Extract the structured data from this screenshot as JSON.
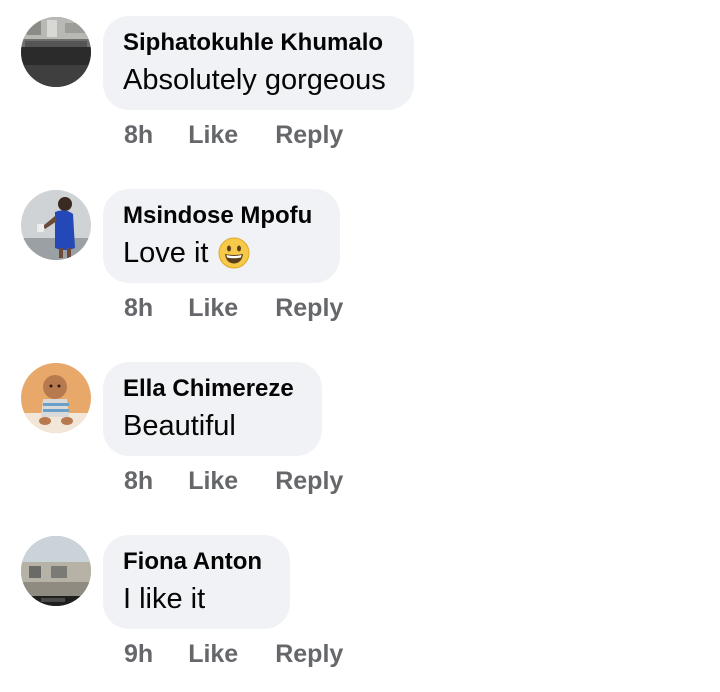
{
  "comments": [
    {
      "author": "Siphatokuhle Khumalo",
      "text": "Absolutely gorgeous",
      "emoji": "",
      "time": "8h",
      "like_label": "Like",
      "reply_label": "Reply",
      "avatar": "avatar-kitchen-photo"
    },
    {
      "author": "Msindose Mpofu",
      "text": "Love it",
      "emoji": "grinning-face-emoji",
      "time": "8h",
      "like_label": "Like",
      "reply_label": "Reply",
      "avatar": "avatar-woman-blue-dress-photo"
    },
    {
      "author": "Ella Chimereze",
      "text": "Beautiful",
      "emoji": "",
      "time": "8h",
      "like_label": "Like",
      "reply_label": "Reply",
      "avatar": "avatar-baby-photo"
    },
    {
      "author": "Fiona Anton",
      "text": "I like it",
      "emoji": "",
      "time": "9h",
      "like_label": "Like",
      "reply_label": "Reply",
      "avatar": "avatar-house-photo"
    }
  ],
  "colors": {
    "bubble_bg": "#f0f2f5",
    "author_text": "#050505",
    "meta_text": "#65676b"
  }
}
